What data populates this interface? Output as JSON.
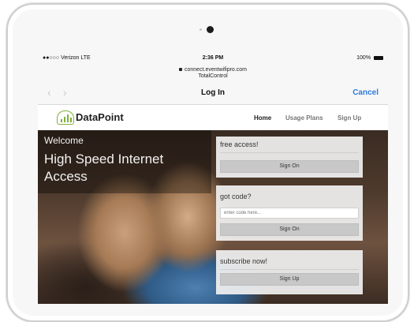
{
  "statusbar": {
    "carrier": "●●○○○ Verizon  LTE",
    "time": "2:36 PM",
    "battery": "100%"
  },
  "browser": {
    "url_line1": "connect.eventwifipro.com",
    "url_line2": "TotalControl",
    "back_icon": "‹",
    "forward_icon": "›",
    "title": "Log In",
    "cancel_label": "Cancel"
  },
  "site": {
    "logo_text": "DataPoint",
    "brand_color": "#7fb13a",
    "menu": [
      "Home",
      "Usage Plans",
      "Sign Up"
    ],
    "active_menu": "Home"
  },
  "hero": {
    "welcome": "Welcome",
    "headline": "High Speed Internet Access"
  },
  "panels": {
    "free_title": "free access!",
    "free_button": "Sign On",
    "code_title": "got code?",
    "code_placeholder": "enter code here...",
    "code_button": "Sign On",
    "subscribe_title": "subscribe now!",
    "subscribe_button": "Sign Up"
  }
}
